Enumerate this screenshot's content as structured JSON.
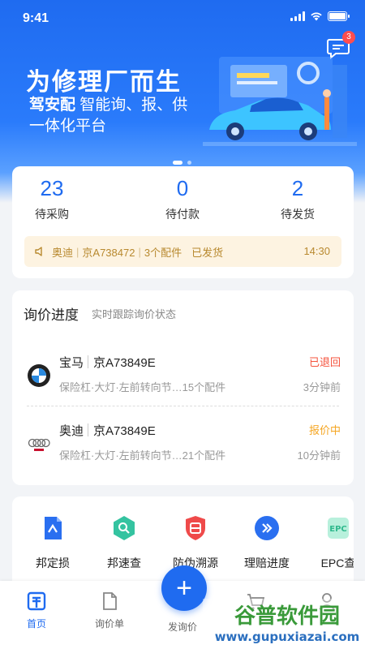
{
  "status_bar": {
    "time": "9:41"
  },
  "header": {
    "message_badge": "3"
  },
  "banner": {
    "title": "为修理厂而生",
    "brand": "驾安配",
    "slogan_rest": "智能询、报、供",
    "slogan_line2": "一体化平台"
  },
  "orders": {
    "stats": [
      {
        "value": "23",
        "label": "待采购"
      },
      {
        "value": "0",
        "label": "待付款"
      },
      {
        "value": "2",
        "label": "待发货"
      }
    ],
    "notice": {
      "brand": "奥迪",
      "plate": "京A738472",
      "parts": "3个配件",
      "status": "已发货",
      "time": "14:30"
    }
  },
  "inquiry": {
    "title": "询价进度",
    "subtitle": "实时跟踪询价状态",
    "items": [
      {
        "brand": "宝马",
        "plate": "京A73849E",
        "status": "已退回",
        "status_color": "#f5533d",
        "detail": "保险杠·大灯·左前转向节…15个配件",
        "ago": "3分钟前"
      },
      {
        "brand": "奥迪",
        "plate": "京A73849E",
        "status": "报价中",
        "status_color": "#f5a623",
        "detail": "保险杠·大灯·左前转向节…21个配件",
        "ago": "10分钟前"
      }
    ]
  },
  "tools": [
    {
      "label": "邦定损",
      "icon": "damage-assess-icon"
    },
    {
      "label": "邦速查",
      "icon": "quick-search-icon"
    },
    {
      "label": "防伪溯源",
      "icon": "anti-fake-icon"
    },
    {
      "label": "理赔进度",
      "icon": "claim-progress-icon"
    },
    {
      "label": "EPC查",
      "icon": "epc-icon"
    }
  ],
  "tabbar": {
    "home": "首页",
    "inquiry_list": "询价单",
    "post_inquiry": "发询价"
  },
  "watermark": {
    "cn": "谷普软件园",
    "url": "www.gupuxiazai.com"
  },
  "colors": {
    "primary": "#1f6bf0",
    "notice_bg": "#fdf3e1",
    "notice_text": "#b8892f"
  }
}
